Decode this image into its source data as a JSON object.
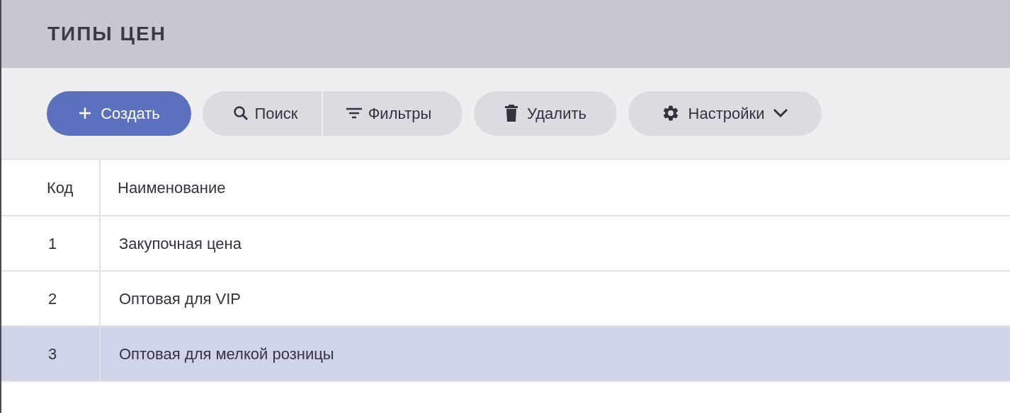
{
  "title": "ТИПЫ ЦЕН",
  "toolbar": {
    "create": "Создать",
    "search": "Поиск",
    "filters": "Фильтры",
    "delete": "Удалить",
    "settings": "Настройки"
  },
  "table": {
    "columns": [
      "Код",
      "Наименование"
    ],
    "rows": [
      {
        "code": "1",
        "name": "Закупочная цена",
        "selected": false
      },
      {
        "code": "2",
        "name": "Оптовая для VIP",
        "selected": false
      },
      {
        "code": "3",
        "name": "Оптовая для мелкой розницы",
        "selected": true
      }
    ]
  }
}
